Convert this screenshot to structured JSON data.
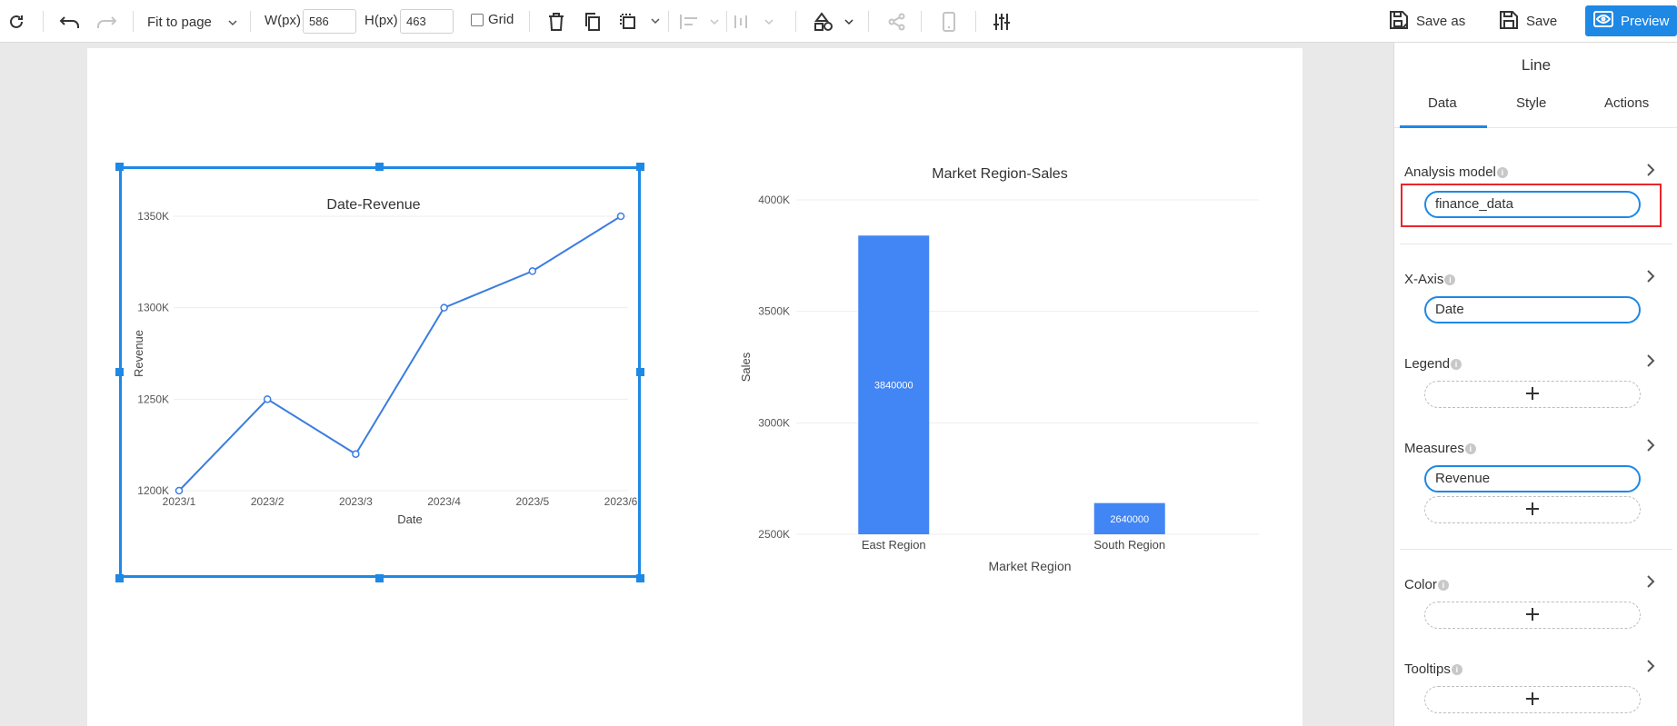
{
  "toolbar": {
    "fit_label": "Fit to page",
    "width_label": "W(px)",
    "width_value": "586",
    "height_label": "H(px)",
    "height_value": "463",
    "grid_label": "Grid",
    "save_as_label": "Save as",
    "save_label": "Save",
    "preview_label": "Preview"
  },
  "panel": {
    "title": "Line",
    "tabs": [
      {
        "label": "Data",
        "active": true
      },
      {
        "label": "Style",
        "active": false
      },
      {
        "label": "Actions",
        "active": false
      }
    ],
    "sections": {
      "analysis_model": {
        "label": "Analysis model",
        "value": "finance_data"
      },
      "x_axis": {
        "label": "X-Axis",
        "value": "Date"
      },
      "legend": {
        "label": "Legend"
      },
      "measures": {
        "label": "Measures",
        "value": "Revenue"
      },
      "color": {
        "label": "Color"
      },
      "tooltips": {
        "label": "Tooltips"
      }
    }
  },
  "colors": {
    "accent": "#1e88e5",
    "bar": "#4285f4",
    "highlight": "#e8262b"
  },
  "chart_data": [
    {
      "type": "line",
      "title": "Date-Revenue",
      "xlabel": "Date",
      "ylabel": "Revenue",
      "categories": [
        "2023/1",
        "2023/2",
        "2023/3",
        "2023/4",
        "2023/5",
        "2023/6"
      ],
      "values": [
        1200000,
        1250000,
        1220000,
        1300000,
        1320000,
        1350000
      ],
      "yticks": [
        1200000,
        1250000,
        1300000,
        1350000
      ],
      "ytick_labels": [
        "1200K",
        "1250K",
        "1300K",
        "1350K"
      ],
      "ylim": [
        1200000,
        1350000
      ],
      "grid": true,
      "selected": true
    },
    {
      "type": "bar",
      "title": "Market Region-Sales",
      "xlabel": "Market Region",
      "ylabel": "Sales",
      "categories": [
        "East Region",
        "South Region"
      ],
      "values": [
        3840000,
        2640000
      ],
      "data_labels": [
        "3840000",
        "2640000"
      ],
      "yticks": [
        2500000,
        3000000,
        3500000,
        4000000
      ],
      "ytick_labels": [
        "2500K",
        "3000K",
        "3500K",
        "4000K"
      ],
      "ylim": [
        2500000,
        4000000
      ],
      "grid": true
    }
  ]
}
